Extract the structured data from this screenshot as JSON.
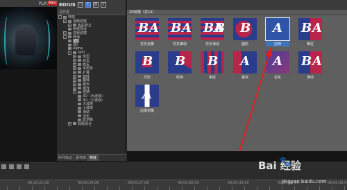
{
  "preview": {
    "plr_label": "PLR",
    "rec_label": "REC"
  },
  "app": {
    "brand": "EDIUS"
  },
  "tree": {
    "header": "文件夹",
    "items": [
      {
        "label": "特效",
        "level": 0,
        "toggle": "-"
      },
      {
        "label": "视频滤镜",
        "level": 1,
        "toggle": "+"
      },
      {
        "label": "色彩校正",
        "level": 2,
        "toggle": "+"
      },
      {
        "label": "系统预设",
        "level": 2,
        "toggle": ""
      },
      {
        "label": "音频滤镜",
        "level": 1,
        "toggle": "+"
      },
      {
        "label": "转场",
        "level": 1,
        "toggle": "-"
      },
      {
        "label": "2D",
        "level": 2,
        "toggle": "",
        "selected": true
      },
      {
        "label": "3D",
        "level": 2,
        "toggle": ""
      },
      {
        "label": "Alpha",
        "level": 2,
        "toggle": ""
      },
      {
        "label": "GPU",
        "level": 2,
        "toggle": "-"
      },
      {
        "label": "单页",
        "level": 3,
        "toggle": "+"
      },
      {
        "label": "双页",
        "level": 3,
        "toggle": "+"
      },
      {
        "label": "四页",
        "level": 3,
        "toggle": "+"
      },
      {
        "label": "手风琴",
        "level": 3,
        "toggle": "+"
      },
      {
        "label": "扩展",
        "level": 3,
        "toggle": "+"
      },
      {
        "label": "旋转",
        "level": 3,
        "toggle": "+"
      },
      {
        "label": "翻转",
        "level": 3,
        "toggle": "+"
      },
      {
        "label": "卷页",
        "level": 3,
        "toggle": "+"
      },
      {
        "label": "爆炸",
        "level": 3,
        "toggle": "+"
      },
      {
        "label": "涟漪",
        "level": 3,
        "toggle": "-"
      },
      {
        "label": "3D（大波浪）",
        "level": 4,
        "toggle": ""
      },
      {
        "label": "3D（小波浪）",
        "level": 4,
        "toggle": ""
      },
      {
        "label": "大波浪",
        "level": 4,
        "toggle": ""
      },
      {
        "label": "小波浪",
        "level": 4,
        "toggle": ""
      },
      {
        "label": "滑动",
        "level": 4,
        "toggle": ""
      },
      {
        "label": "溶化",
        "level": 4,
        "toggle": ""
      },
      {
        "label": "软划像",
        "level": 4,
        "toggle": ""
      },
      {
        "label": "标题混合",
        "level": 2,
        "toggle": "+"
      }
    ],
    "tabs": [
      "序列标记",
      "素材库",
      "特效"
    ]
  },
  "effects": {
    "header": "2D效果（共16）",
    "tiles": [
      {
        "label": "交叉划像",
        "glyph_left": "B",
        "glyph_right": "A",
        "style": "stripes"
      },
      {
        "label": "交叉推动",
        "glyph_left": "B",
        "glyph_right": "A",
        "style": "stripes"
      },
      {
        "label": "交叉滑动",
        "glyph_left": "BA",
        "glyph_right": "B",
        "style": "stripes"
      },
      {
        "label": "圆形",
        "glyph_left": "B",
        "glyph_right": "",
        "style": "circle"
      },
      {
        "label": "拉伸",
        "glyph_left": "A",
        "glyph_right": "",
        "style": "blue",
        "selected": true
      },
      {
        "label": "推拉",
        "glyph_left": "B",
        "glyph_right": "A",
        "style": "split"
      },
      {
        "label": "方形",
        "glyph_left": "B",
        "glyph_right": "",
        "style": "square"
      },
      {
        "label": "时钟",
        "glyph_left": "B",
        "glyph_right": "",
        "style": "clock"
      },
      {
        "label": "条纹",
        "glyph_left": "B",
        "glyph_right": "",
        "style": "bars"
      },
      {
        "label": "板块",
        "glyph_left": "A",
        "glyph_right": "",
        "style": "block"
      },
      {
        "label": "溶化",
        "glyph_left": "A",
        "glyph_right": "",
        "style": "dissolve"
      },
      {
        "label": "滑动",
        "glyph_left": "B",
        "glyph_right": "A",
        "style": "split"
      },
      {
        "label": "边缘划像",
        "glyph_left": "A",
        "glyph_right": "",
        "style": "edge"
      }
    ]
  },
  "timeline": {
    "timecodes": [
      "00;00;21;00",
      "00;00;24;00",
      "00;00;27;00",
      "00;00;30;00",
      "00;00;33;00",
      "00;00;36;00",
      "00;00;39;00"
    ]
  },
  "watermark": {
    "text": "Bai 经验",
    "url": "jingyan.baidu.com"
  },
  "colors": {
    "accent": "#3d74c0",
    "stripe_red": "#b8244a",
    "stripe_blue": "#2a3c8c",
    "rec": "#c02020"
  },
  "icons": [
    "folder-icon",
    "transition-icon",
    "effects-icon",
    "search-icon",
    "paw-icon"
  ]
}
